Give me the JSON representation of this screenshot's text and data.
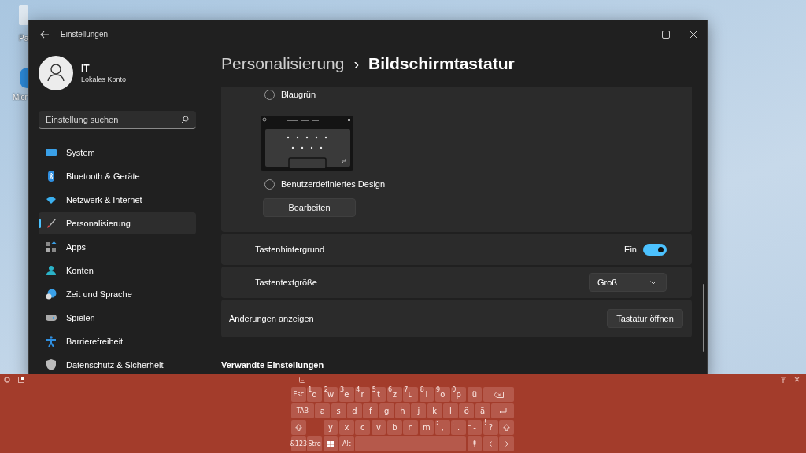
{
  "desktop": {
    "icons": [
      {
        "label": "Pa"
      },
      {
        "label": "Micr"
      }
    ]
  },
  "window": {
    "title": "Einstellungen"
  },
  "account": {
    "name": "IT",
    "type": "Lokales Konto"
  },
  "search": {
    "placeholder": "Einstellung suchen"
  },
  "nav": [
    {
      "label": "System",
      "selected": false
    },
    {
      "label": "Bluetooth & Geräte",
      "selected": false
    },
    {
      "label": "Netzwerk & Internet",
      "selected": false
    },
    {
      "label": "Personalisierung",
      "selected": true
    },
    {
      "label": "Apps",
      "selected": false
    },
    {
      "label": "Konten",
      "selected": false
    },
    {
      "label": "Zeit und Sprache",
      "selected": false
    },
    {
      "label": "Spielen",
      "selected": false
    },
    {
      "label": "Barrierefreiheit",
      "selected": false
    },
    {
      "label": "Datenschutz & Sicherheit",
      "selected": false
    }
  ],
  "breadcrumb": {
    "parent": "Personalisierung",
    "separator": "›",
    "current": "Bildschirmtastatur"
  },
  "themes": [
    {
      "kind": "radio",
      "label": "Blaugrün",
      "selected": false
    },
    {
      "kind": "preview"
    },
    {
      "kind": "radio",
      "label": "Benutzerdefiniertes Design",
      "selected": false
    }
  ],
  "edit_button": "Bearbeiten",
  "settings": [
    {
      "kind": "toggle",
      "label": "Tastenhintergrund",
      "state_text": "Ein",
      "on": true
    },
    {
      "kind": "dropdown",
      "label": "Tastentextgröße",
      "value": "Groß"
    }
  ],
  "preview_row": {
    "label": "Änderungen anzeigen",
    "button": "Tastatur öffnen"
  },
  "related": {
    "heading": "Verwandte Einstellungen"
  },
  "keyboard": {
    "rows": [
      [
        {
          "kind": "text",
          "label": "Esc"
        },
        {
          "kind": "char",
          "label": "q",
          "hint": "1"
        },
        {
          "kind": "char",
          "label": "w",
          "hint": "2"
        },
        {
          "kind": "char",
          "label": "e",
          "hint": "3"
        },
        {
          "kind": "char",
          "label": "r",
          "hint": "4"
        },
        {
          "kind": "char",
          "label": "t",
          "hint": "5"
        },
        {
          "kind": "char",
          "label": "z",
          "hint": "6"
        },
        {
          "kind": "char",
          "label": "u",
          "hint": "7"
        },
        {
          "kind": "char",
          "label": "i",
          "hint": "8"
        },
        {
          "kind": "char",
          "label": "o",
          "hint": "9"
        },
        {
          "kind": "char",
          "label": "p",
          "hint": "0"
        },
        {
          "kind": "char",
          "label": "ü"
        },
        {
          "kind": "backspace"
        }
      ],
      [
        {
          "kind": "tab",
          "label": "TAB"
        },
        {
          "kind": "char",
          "label": "a"
        },
        {
          "kind": "char",
          "label": "s"
        },
        {
          "kind": "char",
          "label": "d"
        },
        {
          "kind": "char",
          "label": "f"
        },
        {
          "kind": "char",
          "label": "g"
        },
        {
          "kind": "char",
          "label": "h"
        },
        {
          "kind": "char",
          "label": "j"
        },
        {
          "kind": "char",
          "label": "k"
        },
        {
          "kind": "char",
          "label": "l"
        },
        {
          "kind": "char",
          "label": "ö"
        },
        {
          "kind": "char",
          "label": "ä"
        },
        {
          "kind": "enter"
        }
      ],
      [
        {
          "kind": "shift"
        },
        {
          "kind": "spacer"
        },
        {
          "kind": "char",
          "label": "y"
        },
        {
          "kind": "char",
          "label": "x"
        },
        {
          "kind": "char",
          "label": "c"
        },
        {
          "kind": "char",
          "label": "v"
        },
        {
          "kind": "char",
          "label": "b"
        },
        {
          "kind": "char",
          "label": "n"
        },
        {
          "kind": "char",
          "label": "m"
        },
        {
          "kind": "char",
          "label": ",",
          "hint": ";"
        },
        {
          "kind": "char",
          "label": ".",
          "hint": ":"
        },
        {
          "kind": "char",
          "label": "-",
          "hint": "_"
        },
        {
          "kind": "char",
          "label": "?",
          "hint": "!"
        },
        {
          "kind": "shift"
        }
      ],
      [
        {
          "kind": "text",
          "label": "&123"
        },
        {
          "kind": "text",
          "label": "Strg"
        },
        {
          "kind": "windows"
        },
        {
          "kind": "text",
          "label": "Alt"
        },
        {
          "kind": "space"
        },
        {
          "kind": "mic"
        },
        {
          "kind": "left"
        },
        {
          "kind": "right"
        }
      ]
    ]
  }
}
